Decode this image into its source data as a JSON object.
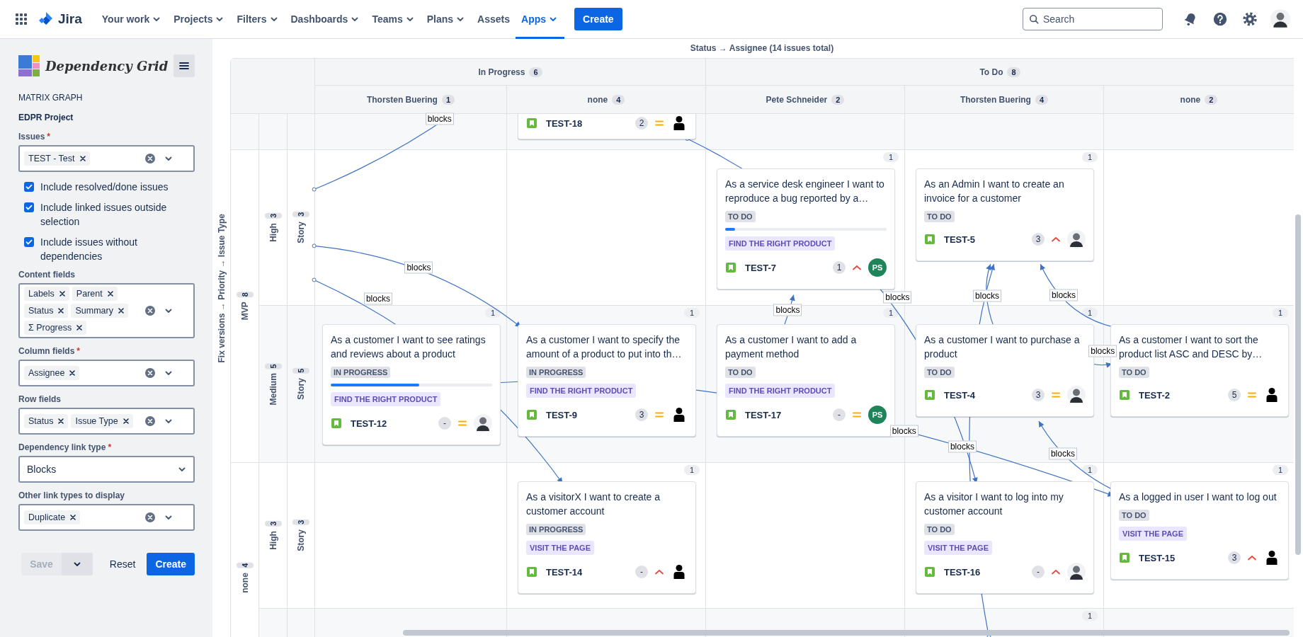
{
  "nav": {
    "product": "Jira",
    "items": [
      {
        "label": "Your work",
        "dropdown": true,
        "selected": false
      },
      {
        "label": "Projects",
        "dropdown": true,
        "selected": false
      },
      {
        "label": "Filters",
        "dropdown": true,
        "selected": false
      },
      {
        "label": "Dashboards",
        "dropdown": true,
        "selected": false
      },
      {
        "label": "Teams",
        "dropdown": true,
        "selected": false
      },
      {
        "label": "Plans",
        "dropdown": true,
        "selected": false
      },
      {
        "label": "Assets",
        "dropdown": false,
        "selected": false
      },
      {
        "label": "Apps",
        "dropdown": true,
        "selected": true
      }
    ],
    "create": "Create",
    "search": {
      "placeholder": "Search"
    }
  },
  "sidebar": {
    "app_name": "Dependency Grid",
    "section": "MATRIX GRAPH",
    "project": "EDPR Project",
    "form": [
      {
        "kind": "multi",
        "label": "Issues",
        "required_mark": "*",
        "tags": [
          "TEST - Test"
        ]
      },
      {
        "kind": "checkbox",
        "label": "Include resolved/done issues",
        "checked": true
      },
      {
        "kind": "checkbox",
        "label": "Include linked issues outside selection",
        "checked": true
      },
      {
        "kind": "checkbox",
        "label": "Include issues without dependencies",
        "checked": true
      },
      {
        "kind": "multi",
        "label": "Content fields",
        "tags": [
          "Labels",
          "Parent",
          "Status",
          "Summary",
          "Σ Progress"
        ]
      },
      {
        "kind": "multi",
        "label": "Column fields",
        "required_mark": "*",
        "tags": [
          "Assignee"
        ]
      },
      {
        "kind": "multi",
        "label": "Row fields",
        "tags": [
          "Status",
          "Issue Type"
        ]
      },
      {
        "kind": "select",
        "label": "Dependency link type",
        "required_mark": "*",
        "value": "Blocks"
      },
      {
        "kind": "multi",
        "label": "Other link types to display",
        "tags": [
          "Duplicate"
        ]
      }
    ],
    "buttons": [
      {
        "label": "Save",
        "kind": "split",
        "disabled": true
      },
      {
        "label": "Reset",
        "kind": "subtle",
        "disabled": false
      },
      {
        "label": "Create",
        "kind": "primary",
        "disabled": false
      }
    ]
  },
  "matrix": {
    "title": "Status → Assignee (14 issues total)",
    "row_axis": "Fix versions → Priority → Issue Type",
    "column_groups": [
      {
        "label": "In Progress",
        "count": "6",
        "columns": [
          {
            "label": "Thorsten Buering",
            "count": "1"
          },
          {
            "label": "none",
            "count": "4"
          }
        ]
      },
      {
        "label": "To Do",
        "count": "8",
        "columns": [
          {
            "label": "Pete Schneider",
            "count": "2"
          },
          {
            "label": "Thorsten Buering",
            "count": "4"
          },
          {
            "label": "none",
            "count": "2"
          }
        ]
      }
    ],
    "row_groups": [
      {
        "children": [
          {
            "children": [
              {
                "cells": [
                  null,
                  {
                    "cards": [
                      {
                        "key": "TEST-18",
                        "count": "2",
                        "priority": {
                          "kind": "medium"
                        },
                        "assignee": {
                          "kind": "person"
                        }
                      }
                    ]
                  },
                  null,
                  null,
                  null
                ]
              }
            ]
          }
        ]
      },
      {
        "label": "MVP",
        "count": "8",
        "children": [
          {
            "label": "High",
            "count": "3",
            "children": [
              {
                "label": "Story",
                "count": "3",
                "cells": [
                  null,
                  null,
                  {
                    "count": "1",
                    "cards": [
                      {
                        "summary": "As a service desk engineer I want to reproduce a bug reported by a…",
                        "status": "TO DO",
                        "level": 0.06,
                        "label": "FIND THE RIGHT PRODUCT",
                        "key": "TEST-7",
                        "count": "1",
                        "priority": {
                          "kind": "high"
                        },
                        "assignee": {
                          "kind": "initials",
                          "initials": "PS"
                        }
                      }
                    ]
                  },
                  {
                    "count": "1",
                    "cards": [
                      {
                        "summary": "As an Admin I want to create an invoice for a customer",
                        "status": "TO DO",
                        "key": "TEST-5",
                        "count": "3",
                        "priority": {
                          "kind": "high"
                        },
                        "assignee": {
                          "kind": "photo"
                        }
                      }
                    ]
                  },
                  null
                ]
              }
            ]
          },
          {
            "label": "Medium",
            "count": "5",
            "children": [
              {
                "label": "Story",
                "count": "5",
                "cells": [
                  {
                    "count": "1",
                    "cards": [
                      {
                        "summary": "As a customer I want to see ratings and reviews about a product",
                        "status": "IN PROGRESS",
                        "level": 0.55,
                        "label": "FIND THE RIGHT PRODUCT",
                        "key": "TEST-12",
                        "count": "-",
                        "priority": {
                          "kind": "medium"
                        },
                        "assignee": {
                          "kind": "photo"
                        }
                      }
                    ]
                  },
                  {
                    "count": "1",
                    "cards": [
                      {
                        "summary": "As a customer I want to specify the amount of a product to put into th…",
                        "status": "IN PROGRESS",
                        "label": "FIND THE RIGHT PRODUCT",
                        "key": "TEST-9",
                        "count": "3",
                        "priority": {
                          "kind": "medium"
                        },
                        "assignee": {
                          "kind": "person"
                        }
                      }
                    ]
                  },
                  {
                    "count": "1",
                    "cards": [
                      {
                        "summary": "As a customer I want to add a payment method",
                        "status": "TO DO",
                        "label": "FIND THE RIGHT PRODUCT",
                        "key": "TEST-17",
                        "count": "-",
                        "priority": {
                          "kind": "medium"
                        },
                        "assignee": {
                          "kind": "initials",
                          "initials": "PS"
                        }
                      }
                    ]
                  },
                  {
                    "count": "1",
                    "cards": [
                      {
                        "summary": "As a customer I want to purchase a product",
                        "status": "TO DO",
                        "key": "TEST-4",
                        "count": "3",
                        "priority": {
                          "kind": "medium"
                        },
                        "assignee": {
                          "kind": "photo"
                        }
                      }
                    ]
                  },
                  {
                    "count": "1",
                    "cards": [
                      {
                        "summary": "As a customer I want to sort the product list ASC and DESC by…",
                        "status": "TO DO",
                        "key": "TEST-2",
                        "count": "5",
                        "priority": {
                          "kind": "medium"
                        },
                        "assignee": {
                          "kind": "person"
                        }
                      }
                    ]
                  }
                ]
              }
            ]
          }
        ]
      },
      {
        "label": "none",
        "count": "4",
        "children": [
          {
            "label": "High",
            "count": "3",
            "children": [
              {
                "label": "Story",
                "count": "3",
                "cells": [
                  null,
                  {
                    "count": "1",
                    "cards": [
                      {
                        "summary": "As a visitorX I want to create a customer account",
                        "status": "IN PROGRESS",
                        "label": "VISIT THE PAGE",
                        "key": "TEST-14",
                        "count": "-",
                        "priority": {
                          "kind": "high"
                        },
                        "assignee": {
                          "kind": "person"
                        }
                      }
                    ]
                  },
                  null,
                  {
                    "count": "1",
                    "cards": [
                      {
                        "summary": "As a visitor I want to log into my customer account",
                        "status": "TO DO",
                        "label": "VISIT THE PAGE",
                        "key": "TEST-16",
                        "count": "-",
                        "priority": {
                          "kind": "high"
                        },
                        "assignee": {
                          "kind": "photo"
                        }
                      }
                    ]
                  },
                  {
                    "count": "1",
                    "cards": [
                      {
                        "summary": "As a logged in user I want to log out",
                        "status": "TO DO",
                        "label": "VISIT THE PAGE",
                        "key": "TEST-15",
                        "count": "3",
                        "priority": {
                          "kind": "high"
                        },
                        "assignee": {
                          "kind": "person"
                        }
                      }
                    ]
                  }
                ]
              }
            ]
          },
          {
            "children": [
              {
                "cells": [
                  null,
                  null,
                  null,
                  {
                    "count": "1"
                  },
                  null
                ]
              }
            ]
          }
        ]
      }
    ],
    "links": [
      {
        "label": "blocks"
      },
      {
        "label": "blocks"
      },
      {
        "label": "blocks"
      },
      {
        "label": "blocks"
      },
      {
        "label": "blocks"
      },
      {
        "label": "blocks"
      },
      {
        "label": "blocks"
      },
      {
        "label": "blocks"
      },
      {
        "label": "blocks"
      },
      {
        "label": "blocks"
      },
      {
        "label": "blocks"
      }
    ]
  }
}
